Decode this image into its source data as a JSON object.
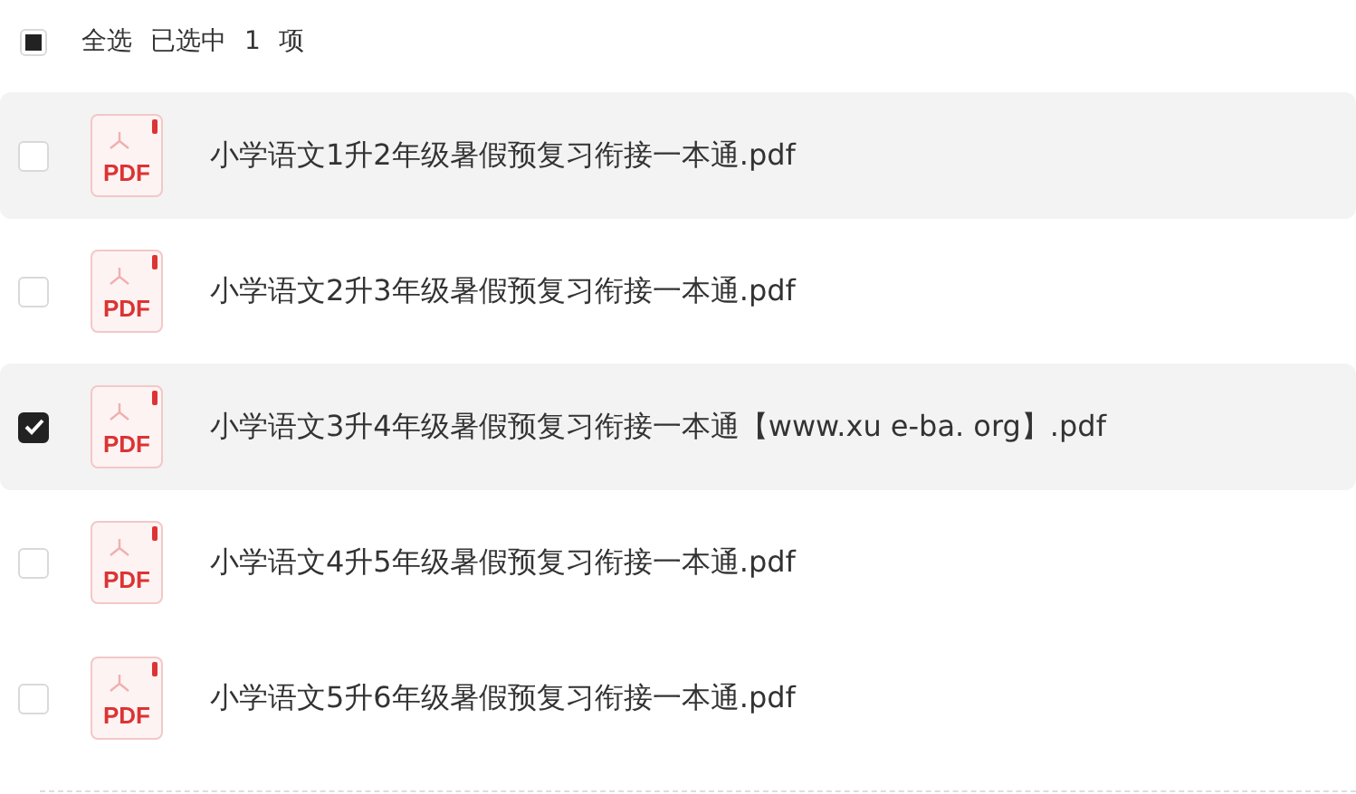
{
  "header": {
    "select_all": {
      "indeterminate": true,
      "label": "全选"
    },
    "selected_label": "已选中",
    "selected_count": "1",
    "unit": "项"
  },
  "files": [
    {
      "name": "小学语文1升2年级暑假预复习衔接一本通.pdf",
      "icon_label": "PDF",
      "checked": false,
      "highlighted": true
    },
    {
      "name": "小学语文2升3年级暑假预复习衔接一本通.pdf",
      "icon_label": "PDF",
      "checked": false,
      "highlighted": false
    },
    {
      "name": "小学语文3升4年级暑假预复习衔接一本通【www.xu e-ba. org】.pdf",
      "icon_label": "PDF",
      "checked": true,
      "highlighted": true
    },
    {
      "name": "小学语文4升5年级暑假预复习衔接一本通.pdf",
      "icon_label": "PDF",
      "checked": false,
      "highlighted": false
    },
    {
      "name": "小学语文5升6年级暑假预复习衔接一本通.pdf",
      "icon_label": "PDF",
      "checked": false,
      "highlighted": false
    }
  ]
}
